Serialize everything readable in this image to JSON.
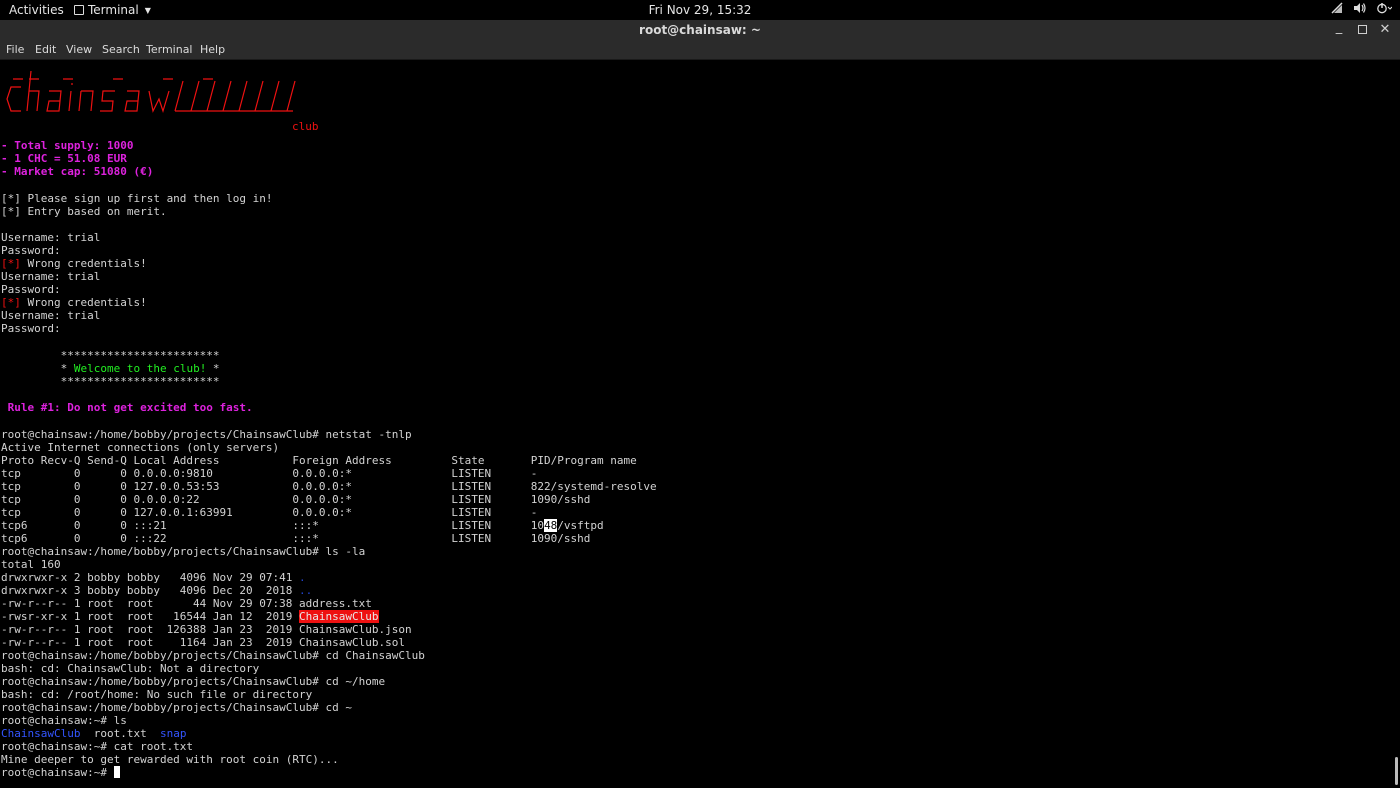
{
  "topbar": {
    "activities": "Activities",
    "app_name": "Terminal",
    "clock": "Fri Nov 29, 15:32",
    "tray_icons": [
      "network-icon",
      "volume-icon",
      "power-icon"
    ]
  },
  "window": {
    "title": "root@chainsaw: ~",
    "controls": [
      "minimize",
      "maximize",
      "close"
    ]
  },
  "menu": [
    "File",
    "Edit",
    "View",
    "Search",
    "Terminal",
    "Help"
  ],
  "terminal": {
    "ascii_logo_word": "chainsaw",
    "ascii_logo_sub": "club",
    "supply": "- Total supply: 1000",
    "price": "- 1 CHC = 51.08 EUR",
    "cap": "- Market cap: 51080 (€)",
    "info1": "[*] Please sign up first and then log in!",
    "info2": "[*] Entry based on merit.",
    "user1": "Username: trial",
    "pass1": "Password:",
    "err_tag1": "[*]",
    "err_msg1": " Wrong credentials!",
    "user2": "Username: trial",
    "pass2": "Password:",
    "err_tag2": "[*]",
    "err_msg2": " Wrong credentials!",
    "user3": "Username: trial",
    "pass3": "Password:",
    "stars1": "         ************************",
    "welcome_pre": "         * ",
    "welcome_msg": "Welcome to the club!",
    "welcome_post": " *",
    "stars2": "         ************************",
    "rule": " Rule #1: Do not get excited too fast.",
    "cmd_netstat": "root@chainsaw:/home/bobby/projects/ChainsawClub# netstat -tnlp",
    "netstat_head1": "Active Internet connections (only servers)",
    "netstat_head2": "Proto Recv-Q Send-Q Local Address           Foreign Address         State       PID/Program name",
    "netstat_rows": [
      "tcp        0      0 0.0.0.0:9810            0.0.0.0:*               LISTEN      -",
      "tcp        0      0 127.0.0.53:53           0.0.0.0:*               LISTEN      822/systemd-resolve",
      "tcp        0      0 0.0.0.0:22              0.0.0.0:*               LISTEN      1090/sshd",
      "tcp        0      0 127.0.0.1:63991         0.0.0.0:*               LISTEN      -"
    ],
    "netstat_row5_pre": "tcp6       0      0 :::21                   :::*                    LISTEN      10",
    "netstat_row5_sel": "48",
    "netstat_row5_post": "/vsftpd",
    "netstat_row6": "tcp6       0      0 :::22                   :::*                    LISTEN      1090/sshd",
    "cmd_ls": "root@chainsaw:/home/bobby/projects/ChainsawClub# ls -la",
    "ls_total": "total 160",
    "ls_dot_pre": "drwxrwxr-x 2 bobby bobby   4096 Nov 29 07:41 ",
    "ls_dot_name": ".",
    "ls_dotdot_pre": "drwxrwxr-x 3 bobby bobby   4096 Dec 20  2018 ",
    "ls_dotdot_name": "..",
    "ls_addr": "-rw-r--r-- 1 root  root      44 Nov 29 07:38 address.txt",
    "ls_club_pre": "-rwsr-xr-x 1 root  root   16544 Jan 12  2019 ",
    "ls_club_name": "ChainsawClub",
    "ls_json": "-rw-r--r-- 1 root  root  126388 Jan 23  2019 ChainsawClub.json",
    "ls_sol": "-rw-r--r-- 1 root  root    1164 Jan 23  2019 ChainsawClub.sol",
    "cmd_cd1": "root@chainsaw:/home/bobby/projects/ChainsawClub# cd ChainsawClub",
    "err_cd1": "bash: cd: ChainsawClub: Not a directory",
    "cmd_cd2": "root@chainsaw:/home/bobby/projects/ChainsawClub# cd ~/home",
    "err_cd2": "bash: cd: /root/home: No such file or directory",
    "cmd_cd3": "root@chainsaw:/home/bobby/projects/ChainsawClub# cd ~",
    "cmd_ls2": "root@chainsaw:~# ls",
    "ls2_dir1": "ChainsawClub",
    "ls2_file": "  root.txt  ",
    "ls2_dir2": "snap",
    "cmd_cat": "root@chainsaw:~# cat root.txt",
    "cat_out": "Mine deeper to get rewarded with root coin (RTC)...",
    "prompt": "root@chainsaw:~# "
  }
}
